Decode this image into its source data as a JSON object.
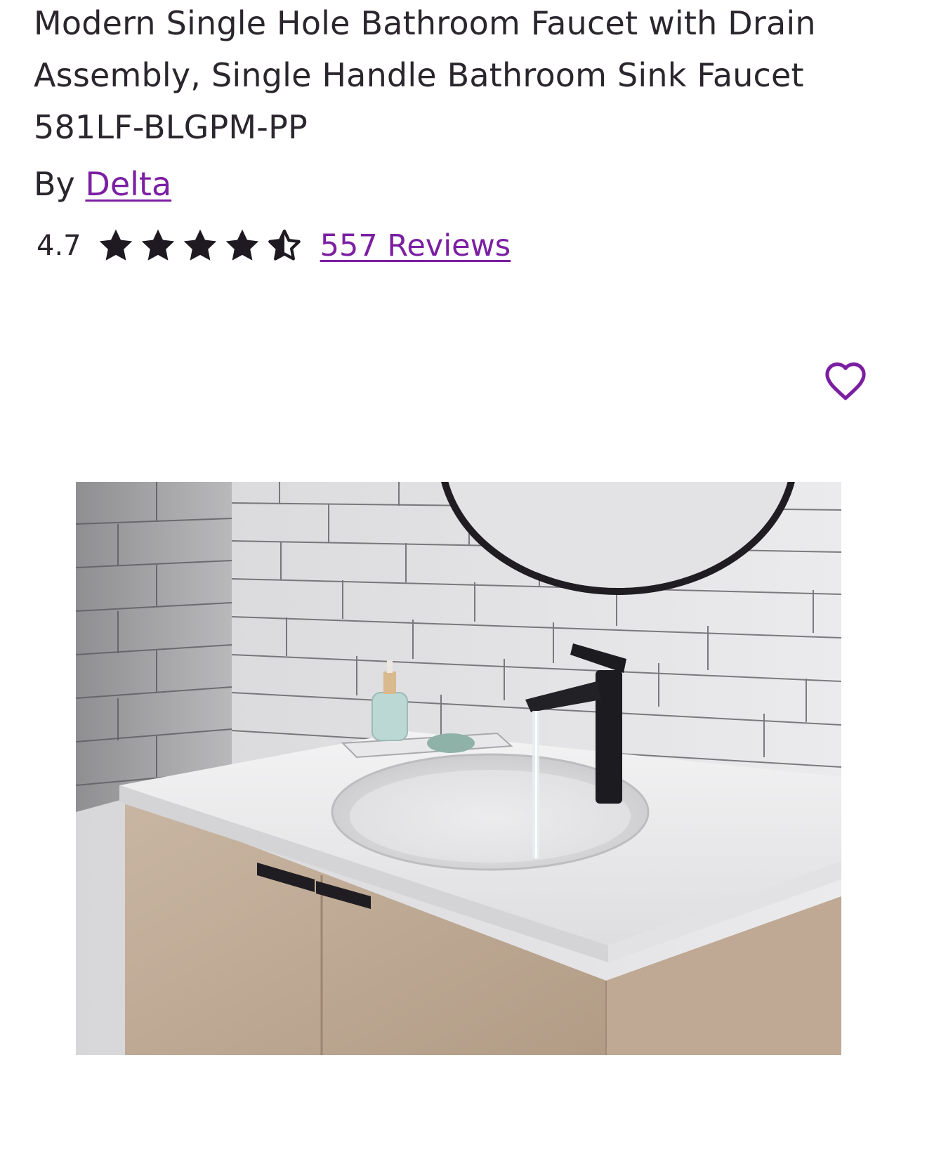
{
  "product": {
    "title": "Modern Single Hole Bathroom Faucet with Drain Assembly, Single Handle Bathroom Sink Faucet 581LF-BLGPM-PP",
    "by_label": "By",
    "brand": "Delta",
    "rating": "4.7",
    "rating_value": 4.7,
    "rating_max": 5,
    "reviews_label": "557 Reviews"
  },
  "icons": {
    "star": "star-icon",
    "half_star": "half-star-icon",
    "favorite": "heart-icon"
  },
  "colors": {
    "link": "#7b1fa2",
    "text": "#2b262d",
    "star": "#1f1a22"
  },
  "image": {
    "alt": "Bathroom vanity with white countertop, undermount sink and matte black single handle faucet"
  }
}
